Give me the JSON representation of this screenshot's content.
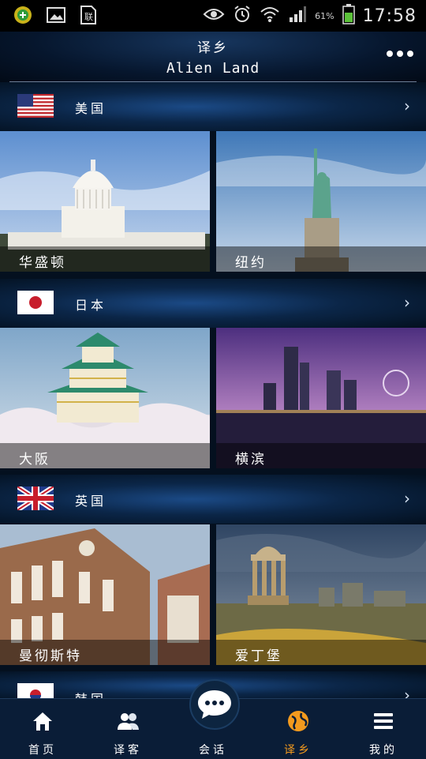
{
  "status_bar": {
    "left_icons": [
      "app-badge-icon",
      "image-icon",
      "sim-card-icon"
    ],
    "right_icons": [
      "eye-icon",
      "alarm-icon",
      "wifi-icon",
      "signal-icon",
      "battery-icon"
    ],
    "battery_percent": "61%",
    "time": "17:58"
  },
  "header": {
    "title_cn": "译乡",
    "title_en": "Alien Land",
    "more_icon": "more-horizontal-icon"
  },
  "countries": [
    {
      "name": "美国",
      "flag": "us-flag",
      "cities": [
        {
          "name": "华盛顿",
          "image": "capitol-building"
        },
        {
          "name": "纽约",
          "image": "statue-of-liberty"
        }
      ]
    },
    {
      "name": "日本",
      "flag": "japan-flag",
      "cities": [
        {
          "name": "大阪",
          "image": "osaka-castle"
        },
        {
          "name": "横滨",
          "image": "yokohama-night-skyline"
        }
      ]
    },
    {
      "name": "英国",
      "flag": "uk-flag",
      "cities": [
        {
          "name": "曼彻斯特",
          "image": "manchester-building"
        },
        {
          "name": "爱丁堡",
          "image": "edinburgh-monument"
        }
      ]
    },
    {
      "name": "韩国",
      "flag": "korea-flag",
      "cities": []
    }
  ],
  "bottom_nav": {
    "items": [
      {
        "label": "首页",
        "icon": "home-icon",
        "active": false
      },
      {
        "label": "译客",
        "icon": "people-icon",
        "active": false
      },
      {
        "label": "会话",
        "icon": "chat-bubble-icon",
        "active": false
      },
      {
        "label": "译乡",
        "icon": "globe-icon",
        "active": true
      },
      {
        "label": "我的",
        "icon": "menu-icon",
        "active": false
      }
    ]
  },
  "colors": {
    "accent": "#f39a1e",
    "background": "#04101f",
    "nav_background": "#0a1d37"
  }
}
